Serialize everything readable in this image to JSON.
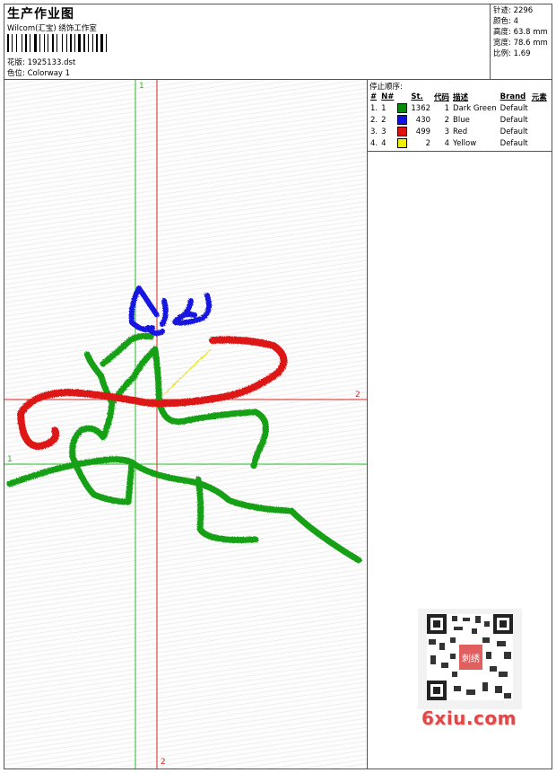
{
  "header": {
    "title": "生产作业图",
    "studio": "Wilcom(汇宝) 绣饰工作室",
    "design_label": "花版:",
    "design_value": "1925133.dst",
    "colorway_label": "色位:",
    "colorway_value": "Colorway 1"
  },
  "stats": {
    "stitches_label": "针迹:",
    "stitches_value": "2296",
    "colors_label": "颜色:",
    "colors_value": "4",
    "height_label": "高度:",
    "height_value": "63.8 mm",
    "width_label": "宽度:",
    "width_value": "78.6 mm",
    "scale_label": "比例:",
    "scale_value": "1.69"
  },
  "stop_sequence": {
    "title": "停止顺序:",
    "columns": [
      "#",
      "N#",
      "St.",
      "代码",
      "描述",
      "Brand",
      "元素"
    ],
    "rows": [
      {
        "index": "1.",
        "n": "1",
        "color": "#0a8a0a",
        "stitches": "1362",
        "code": "1",
        "desc": "Dark Green",
        "brand": "Default"
      },
      {
        "index": "2.",
        "n": "2",
        "color": "#1010e0",
        "stitches": "430",
        "code": "2",
        "desc": "Blue",
        "brand": "Default"
      },
      {
        "index": "3.",
        "n": "3",
        "color": "#e01010",
        "stitches": "499",
        "code": "3",
        "desc": "Red",
        "brand": "Default"
      },
      {
        "index": "4.",
        "n": "4",
        "color": "#f0f000",
        "stitches": "2",
        "code": "4",
        "desc": "Yellow",
        "brand": "Default"
      }
    ]
  },
  "axes": {
    "green_v": "1",
    "red_h": "2",
    "green_h": "1",
    "red_v": "2",
    "green_color": "#22bb22",
    "red_color": "#dd2222"
  },
  "watermark": {
    "site": "6xiu.com",
    "stamp": "刺绣"
  }
}
